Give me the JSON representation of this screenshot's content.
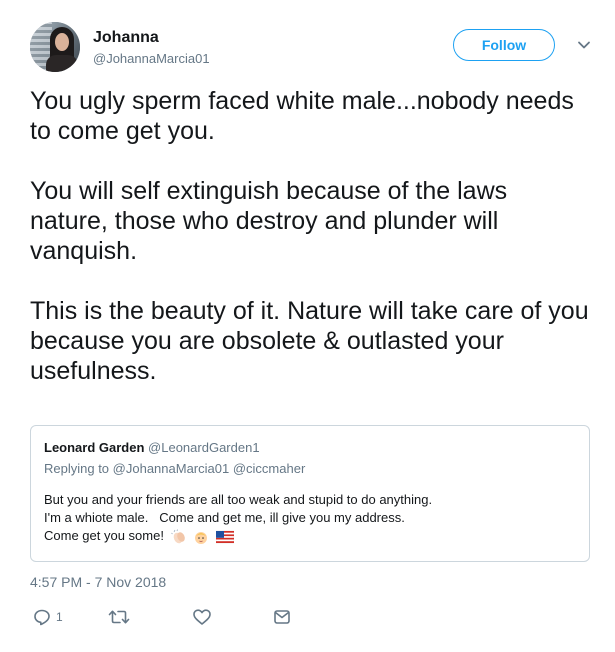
{
  "author": {
    "name": "Johanna",
    "handle": "@JohannaMarcia01",
    "follow_label": "Follow"
  },
  "tweet": {
    "paragraphs": [
      "You ugly sperm faced white male...nobody needs to come get you.",
      "You will self extinguish because of the laws nature, those who destroy and plunder will vanquish.",
      "This is the beauty of it. Nature will take care of you because you are obsolete & outlasted your usefulness."
    ],
    "timestamp": "4:57 PM - 7 Nov 2018"
  },
  "quoted": {
    "name": "Leonard Garden",
    "handle": "@LeonardGarden1",
    "replying_prefix": "Replying to",
    "replying_to": [
      "@JohannaMarcia01",
      "@ciccmaher"
    ],
    "lines": [
      "But you and your friends are all too weak and stupid to do anything.",
      "I'm a whiote male.   Come and get me, ill give you my address.",
      "Come get you some!"
    ],
    "emoji": [
      "clapping-hands",
      "baby-face",
      "us-flag"
    ]
  },
  "actions": {
    "reply_count": "1",
    "icons": [
      "reply-icon",
      "retweet-icon",
      "like-icon",
      "message-icon"
    ]
  },
  "colors": {
    "accent": "#1da1f2",
    "secondary_text": "#657786",
    "border": "#ccd6dd"
  }
}
